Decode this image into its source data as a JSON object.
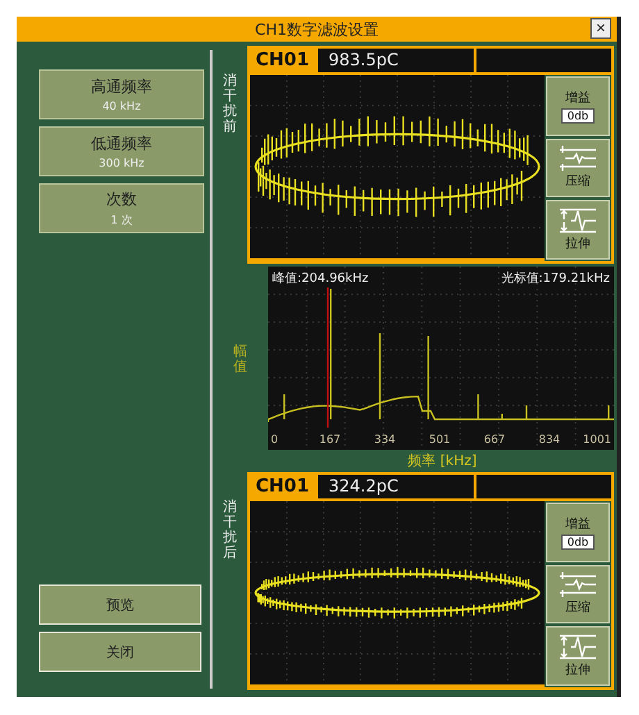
{
  "window": {
    "title": "CH1数字滤波设置",
    "close": "×"
  },
  "params": [
    {
      "label": "高通频率",
      "value": "40 kHz"
    },
    {
      "label": "低通频率",
      "value": "300 kHz"
    },
    {
      "label": "次数",
      "value": "1 次"
    }
  ],
  "buttons": [
    "预览",
    "关闭"
  ],
  "scopes": [
    {
      "side_label": "消干扰前",
      "channel": "CH01",
      "reading": "983.5pC",
      "kind": "noisy",
      "gain_label": "增益",
      "gain_value": "0db",
      "compress": "压缩",
      "stretch": "拉伸"
    },
    {
      "side_label": "消干扰后",
      "channel": "CH01",
      "reading": "324.2pC",
      "kind": "filtered",
      "gain_label": "增益",
      "gain_value": "0db",
      "compress": "压缩",
      "stretch": "拉伸"
    }
  ],
  "spectrum": {
    "peak_label": "峰值:204.96kHz",
    "cursor_label": "光标值:179.21kHz",
    "ylabel": "幅值",
    "xlabel": "频率 [kHz]",
    "xtick_labels": [
      "0",
      "167",
      "334",
      "501",
      "667",
      "834",
      "1001"
    ]
  }
}
